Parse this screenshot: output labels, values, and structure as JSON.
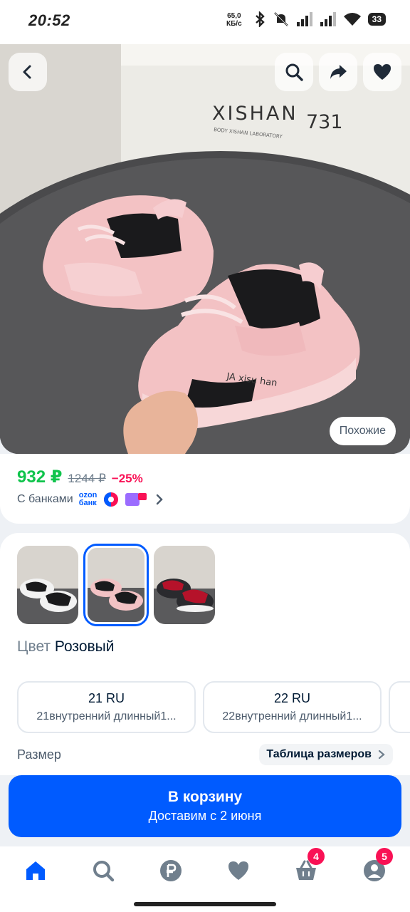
{
  "status_bar": {
    "time": "20:52",
    "speed_value": "65,0",
    "speed_unit": "КБ/с",
    "battery": "33",
    "icons": [
      "bluetooth-icon",
      "mute-icon",
      "signal-icon",
      "signal-icon",
      "wifi-icon",
      "battery-icon"
    ]
  },
  "hero": {
    "box_brand": "XISHAN",
    "box_brand_num": "731",
    "box_sub": "BODY XISHAN LABORATORY",
    "shoe_text": "JA xisu han",
    "similar_label": "Похожие",
    "buttons": [
      "back-icon",
      "search-icon",
      "share-icon",
      "heart-icon"
    ]
  },
  "price": {
    "current": "932 ₽",
    "old": "1244 ₽",
    "discount": "−25%",
    "banks_label": "С банками",
    "ozon_bank_line1": "ozon",
    "ozon_bank_line2": "банк"
  },
  "variants": {
    "thumbs": [
      {
        "name": "black-white",
        "selected": false
      },
      {
        "name": "pink",
        "selected": true
      },
      {
        "name": "black-red",
        "selected": false
      }
    ],
    "color_label": "Цвет",
    "color_value": "Розовый"
  },
  "sizes": {
    "options": [
      {
        "main": "21 RU",
        "sub": "21внутренний длинный1..."
      },
      {
        "main": "22 RU",
        "sub": "22внутренний длинный1..."
      }
    ],
    "label": "Размер",
    "table_link": "Таблица размеров"
  },
  "cart": {
    "title": "В корзину",
    "subtitle": "Доставим с 2 июня"
  },
  "nav": {
    "cart_badge": "4",
    "profile_badge": "5"
  },
  "colors": {
    "accent": "#005bff",
    "price_green": "#10c44c",
    "discount_pink": "#f91155"
  }
}
